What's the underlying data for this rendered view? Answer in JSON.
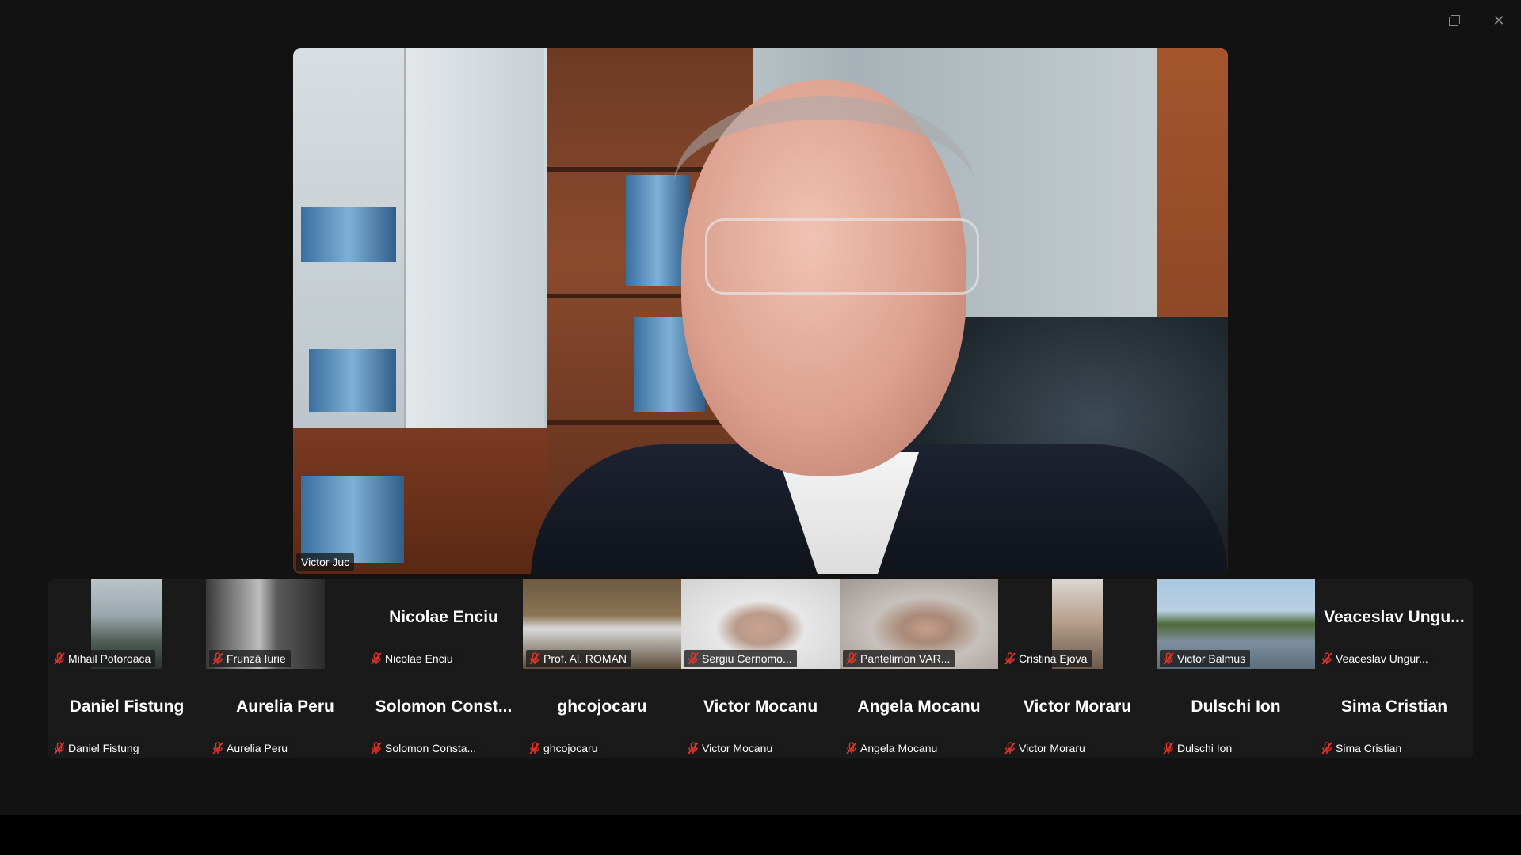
{
  "window": {
    "minimize_icon": "minimize-icon",
    "restore_icon": "restore-icon",
    "close_icon": "close-icon",
    "close_glyph": "✕"
  },
  "speaker": {
    "name": "Victor Juc"
  },
  "colors": {
    "background": "#121212",
    "gallery_bg": "#1a1a1a",
    "muted_mic": "#e0342b"
  },
  "gallery": {
    "row1": [
      {
        "id": "p1",
        "display_name": "Mihail Potoroaca",
        "video": true,
        "muted": true
      },
      {
        "id": "p2",
        "display_name": "Frunză Iurie",
        "video": true,
        "muted": true
      },
      {
        "id": "p3",
        "display_name": "Nicolae Enciu",
        "big_name": "Nicolae Enciu",
        "video": false,
        "muted": true
      },
      {
        "id": "p4",
        "display_name": "Prof. Al. ROMAN",
        "video": true,
        "muted": true
      },
      {
        "id": "p5",
        "display_name": "Sergiu Cernomo...",
        "video": true,
        "muted": true
      },
      {
        "id": "p6",
        "display_name": "Pantelimon VAR...",
        "video": true,
        "muted": true
      },
      {
        "id": "p7",
        "display_name": "Cristina Ejova",
        "video": true,
        "muted": true
      },
      {
        "id": "p8",
        "display_name": "Victor Balmus",
        "video": true,
        "muted": true
      },
      {
        "id": "p9",
        "display_name": "Veaceslav Ungur...",
        "big_name": "Veaceslav  Ungu...",
        "video": false,
        "muted": true
      }
    ],
    "row2": [
      {
        "id": "q1",
        "display_name": "Daniel Fistung",
        "big_name": "Daniel Fistung",
        "muted": true
      },
      {
        "id": "q2",
        "display_name": "Aurelia Peru",
        "big_name": "Aurelia Peru",
        "muted": true
      },
      {
        "id": "q3",
        "display_name": "Solomon Consta...",
        "big_name": "Solomon  Const...",
        "muted": true
      },
      {
        "id": "q4",
        "display_name": "ghcojocaru",
        "big_name": "ghcojocaru",
        "muted": true
      },
      {
        "id": "q5",
        "display_name": "Victor  Mocanu",
        "big_name": "Victor  Mocanu",
        "muted": true
      },
      {
        "id": "q6",
        "display_name": "Angela Mocanu",
        "big_name": "Angela Mocanu",
        "muted": true
      },
      {
        "id": "q7",
        "display_name": "Victor Moraru",
        "big_name": "Victor Moraru",
        "muted": true
      },
      {
        "id": "q8",
        "display_name": "Dulschi Ion",
        "big_name": "Dulschi Ion",
        "muted": true
      },
      {
        "id": "q9",
        "display_name": "Sima Cristian",
        "big_name": "Sima Cristian",
        "muted": true
      }
    ]
  }
}
